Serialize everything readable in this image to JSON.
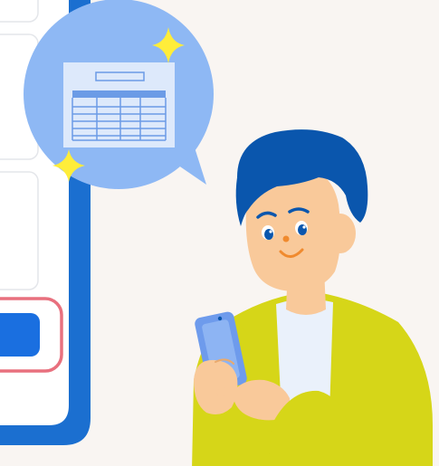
{
  "colors": {
    "background": "#f9f5f2",
    "phone_frame": "#1b6fd0",
    "phone_screen": "#ffffff",
    "card_border": "#e4e6ea",
    "cta_button": "#1a6fe0",
    "cta_highlight": "#e8707e",
    "speech_bubble": "#8eb8f4",
    "document": "#dde9fb",
    "document_lines": "#6b9be6",
    "sparkle": "#ffed3a",
    "hair": "#0a56ad",
    "skin": "#f9c99a",
    "shirt": "#eaf1fb",
    "jacket": "#d6d618",
    "handheld_phone": "#6e9bec"
  },
  "icons": {
    "document": "spreadsheet-document-icon",
    "sparkle": "sparkle-icon"
  }
}
